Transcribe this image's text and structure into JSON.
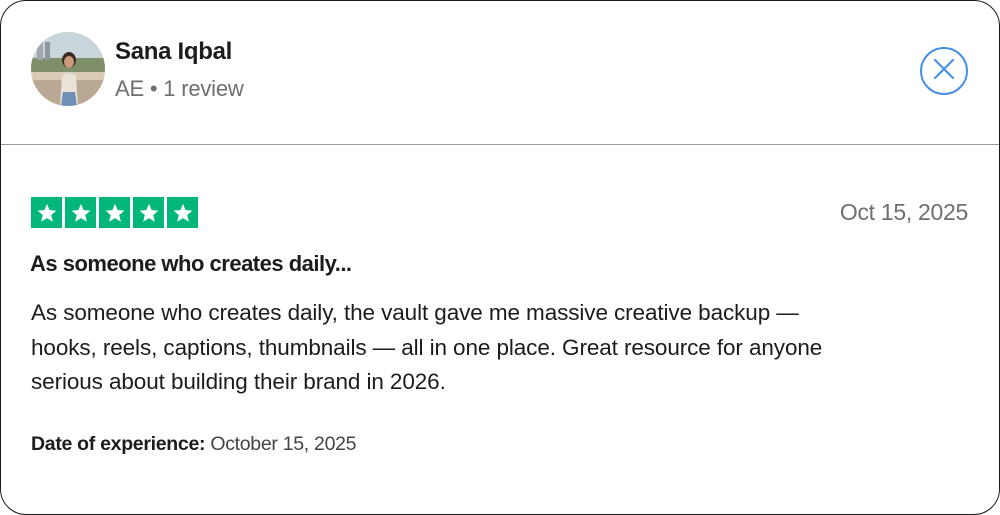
{
  "reviewer": {
    "name": "Sana Iqbal",
    "meta": "AE • 1 review"
  },
  "review": {
    "rating": 5,
    "max_rating": 5,
    "date": "Oct 15, 2025",
    "title": "As someone who creates daily...",
    "body": "As someone who creates daily, the vault gave me massive creative backup — hooks, reels, captions, thumbnails — all in one place. Great resource for anyone serious about building their brand in 2026.",
    "experience_label": "Date of experience:",
    "experience_value": "October 15, 2025"
  },
  "icons": {
    "close": "close-icon",
    "star": "star-icon"
  },
  "colors": {
    "star_green": "#00b67a",
    "close_blue": "#4a90e2",
    "muted_text": "#6f6f6f"
  }
}
